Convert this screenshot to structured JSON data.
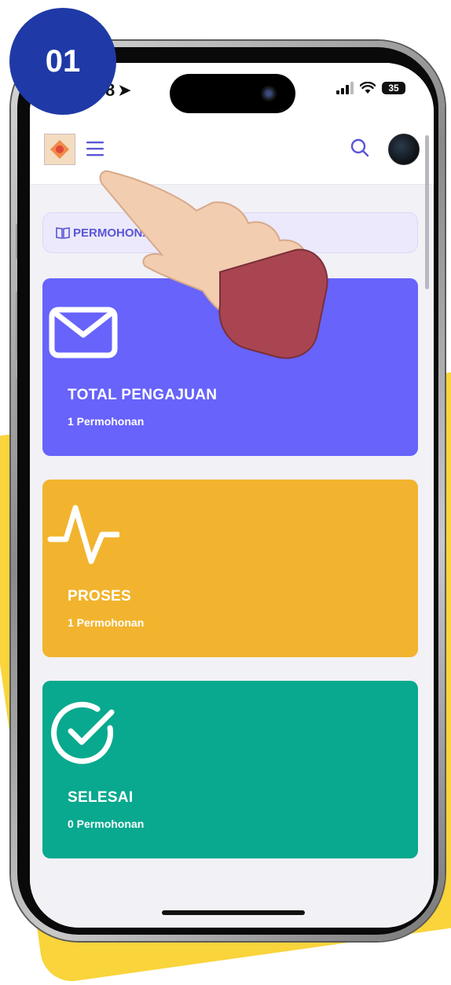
{
  "step_badge": "01",
  "status_bar": {
    "time": "8",
    "battery": "35"
  },
  "header": {
    "menu_icon": "menu-icon",
    "search_icon": "search-icon"
  },
  "breadcrumb": {
    "label": "PERMOHONA",
    "icon": "book-icon"
  },
  "cards": [
    {
      "title": "TOTAL PENGAJUAN",
      "subtitle": "1 Permohonan",
      "icon": "mail-icon",
      "color": "#6763fb"
    },
    {
      "title": "PROSES",
      "subtitle": "1 Permohonan",
      "icon": "activity-icon",
      "color": "#f2b42e"
    },
    {
      "title": "SELESAI",
      "subtitle": "0 Permohonan",
      "icon": "check-circle-icon",
      "color": "#08a98f"
    }
  ],
  "colors": {
    "accent": "#5a55d6",
    "badge": "#1f3aa6",
    "backdrop": "#f9d43b"
  }
}
